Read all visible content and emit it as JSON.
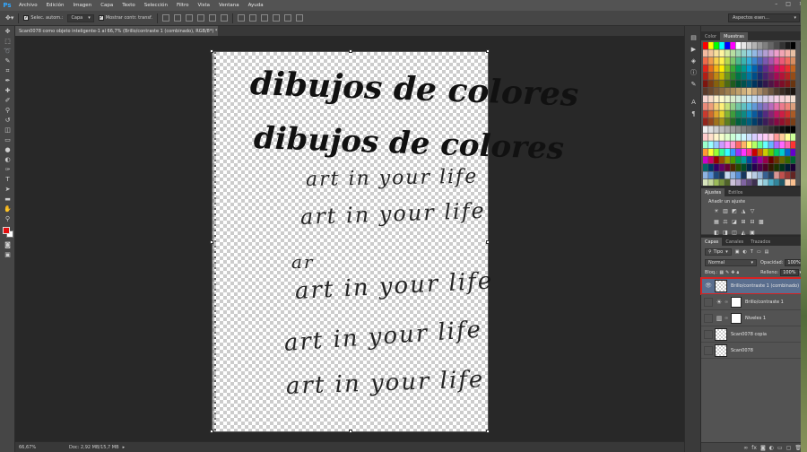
{
  "menubar": {
    "logo": "Ps",
    "items": [
      "Archivo",
      "Edición",
      "Imagen",
      "Capa",
      "Texto",
      "Selección",
      "Filtro",
      "Vista",
      "Ventana",
      "Ayuda"
    ],
    "minimize": "–",
    "maximize": "□",
    "close": "✕"
  },
  "options": {
    "auto_select_label": "Selec. autom.:",
    "auto_select_value": "Capa",
    "show_transform_label": "Mostrar contr. transf.",
    "workspace": "Aspectos esen..."
  },
  "document": {
    "tab_title": "Scan0078 como objeto inteligente-1 al 66,7% (Brillo/contraste 1 (combinado), RGB/8*) *",
    "tab_close": "×",
    "lines": [
      {
        "text": "dibujos de colores",
        "style": "bold"
      },
      {
        "text": "dibujos de colores",
        "style": "bold"
      },
      {
        "text": "art in your life",
        "style": "thin"
      },
      {
        "text": "art in your life",
        "style": "thin"
      },
      {
        "text": "ar",
        "style": "thin"
      },
      {
        "text": "art in your life",
        "style": "thin"
      },
      {
        "text": "art in your life",
        "style": "thin"
      },
      {
        "text": "art in your life",
        "style": "thin"
      }
    ]
  },
  "status": {
    "zoom": "66,67%",
    "doc": "Doc: 2,92 MB/15,7 MB"
  },
  "swatches": {
    "tabs": [
      "Color",
      "Muestras"
    ],
    "active": "Muestras",
    "top_row": [
      "#ff0000",
      "#ffff00",
      "#00ff00",
      "#00ffff",
      "#0000ff",
      "#ff00ff",
      "#ffffff",
      "#e6e6e6",
      "#cccccc",
      "#b3b3b3",
      "#999999",
      "#808080",
      "#666666",
      "#4d4d4d",
      "#333333",
      "#1a1a1a",
      "#000000"
    ],
    "rows": [
      [
        "#f2b9a0",
        "#f4c59a",
        "#f8e09b",
        "#fff5a0",
        "#d8eba0",
        "#b7dea0",
        "#9ed5b4",
        "#93d2cd",
        "#8fcfe7",
        "#93b9e3",
        "#9aa0d6",
        "#b39ed2",
        "#cf9ed3",
        "#ee9fcb",
        "#f2a5b4",
        "#f5b0a8",
        "#e8c0a4"
      ],
      [
        "#ed6a4a",
        "#f09a48",
        "#f7cf4a",
        "#fff14d",
        "#b5d84e",
        "#7bc46a",
        "#4cb88c",
        "#3bb4b0",
        "#36acd8",
        "#3c86cf",
        "#4f63b8",
        "#7d58b0",
        "#a852ae",
        "#e14e9a",
        "#ec5a78",
        "#f06a5e",
        "#d88e62"
      ],
      [
        "#e2231a",
        "#e8701a",
        "#f5b416",
        "#ffec00",
        "#8fc41f",
        "#3aa935",
        "#009a5b",
        "#009b8f",
        "#0099d3",
        "#0064b0",
        "#23388e",
        "#5e2b8f",
        "#942682",
        "#d50f6d",
        "#e6174a",
        "#ea2e2e",
        "#c2631e"
      ],
      [
        "#b21e15",
        "#b55718",
        "#c18a12",
        "#c8b800",
        "#6f981a",
        "#2c8329",
        "#007548",
        "#00766e",
        "#0077a3",
        "#004d88",
        "#1b2b6e",
        "#48216e",
        "#721d64",
        "#a50b54",
        "#b41239",
        "#b62323",
        "#954c17"
      ],
      [
        "#7d150f",
        "#7f3d11",
        "#87610c",
        "#8c8100",
        "#4e6b12",
        "#1f5c1d",
        "#005232",
        "#00524d",
        "#005372",
        "#00355f",
        "#131e4d",
        "#32174d",
        "#501446",
        "#73083b",
        "#7e0d28",
        "#801818",
        "#693510"
      ],
      [
        "#5a3a2a",
        "#6b4a30",
        "#7c5b38",
        "#8d6c42",
        "#9c7d4e",
        "#ad8e5c",
        "#bf9f6b",
        "#d0b07b",
        "#e1c18b",
        "#c7a57a",
        "#a88a66",
        "#8a6f52",
        "#6b5540",
        "#4d3b2e",
        "#3a2c22",
        "#2a1f18",
        "#1b140f"
      ],
      [
        "#f7d5d0",
        "#f9ddc8",
        "#fcefc8",
        "#fffbcc",
        "#ecf4cc",
        "#dbedcd",
        "#cfe9da",
        "#c9e8e5",
        "#c7e6f2",
        "#c9dcf1",
        "#ccd0ea",
        "#d8cfe8",
        "#e6cfe8",
        "#f6d0e5",
        "#f8d3da",
        "#fad7d3",
        "#f3dfd1"
      ],
      [
        "#e98a7a",
        "#ee9f7a",
        "#f6cf78",
        "#fff07a",
        "#c7e27a",
        "#94cf8a",
        "#6fc4a4",
        "#61c1c0",
        "#5cbbe2",
        "#6199d7",
        "#7077c4",
        "#9270bd",
        "#b86bbc",
        "#e670ab",
        "#ec7a8d",
        "#ef857b",
        "#dca07e"
      ],
      [
        "#c93a2e",
        "#cf6a2e",
        "#dea32c",
        "#e6d32c",
        "#86b432",
        "#3e9c3c",
        "#128a5e",
        "#0e8a82",
        "#0a88be",
        "#0a5b9e",
        "#1e347f",
        "#542a80",
        "#862576",
        "#c01664",
        "#ce1e45",
        "#d0302e",
        "#aa5b26"
      ],
      [
        "#92261d",
        "#95471e",
        "#a0721b",
        "#a6951a",
        "#5e7f1f",
        "#276b24",
        "#006040",
        "#00605b",
        "#00607f",
        "#003f6b",
        "#172659",
        "#3b1c59",
        "#5e1850",
        "#870943",
        "#930f2e",
        "#94201e",
        "#7a3f17"
      ],
      [
        "#f0f0f0",
        "#e0e0e0",
        "#d0d0d0",
        "#c0c0c0",
        "#b0b0b0",
        "#a0a0a0",
        "#909090",
        "#808080",
        "#707070",
        "#606060",
        "#505050",
        "#404040",
        "#303030",
        "#202020",
        "#101010",
        "#080808",
        "#000000"
      ],
      [
        "#ffcccc",
        "#ffe0cc",
        "#fff5cc",
        "#f5ffcc",
        "#e0ffcc",
        "#ccffd6",
        "#ccfff0",
        "#ccf5ff",
        "#cce0ff",
        "#d6ccff",
        "#f0ccff",
        "#ffccf5",
        "#ffcce0",
        "#ff9999",
        "#ffcc99",
        "#ffff99",
        "#ccff99"
      ],
      [
        "#99ffcc",
        "#99ffff",
        "#99ccff",
        "#cc99ff",
        "#ff99ff",
        "#ff99cc",
        "#ff6666",
        "#ffb366",
        "#ffff66",
        "#b3ff66",
        "#66ff99",
        "#66ffff",
        "#66b3ff",
        "#b366ff",
        "#ff66ff",
        "#ff66b3",
        "#ff3333"
      ],
      [
        "#ff9933",
        "#ffff33",
        "#99ff33",
        "#33ff99",
        "#33ffff",
        "#3399ff",
        "#9933ff",
        "#ff33ff",
        "#ff3399",
        "#cc0000",
        "#cc6600",
        "#cccc00",
        "#66cc00",
        "#00cc66",
        "#00cccc",
        "#0066cc",
        "#6600cc"
      ],
      [
        "#cc00cc",
        "#cc0066",
        "#990000",
        "#994c00",
        "#999900",
        "#4c9900",
        "#00994c",
        "#009999",
        "#004c99",
        "#4c0099",
        "#990099",
        "#99004c",
        "#660000",
        "#663300",
        "#666600",
        "#336600",
        "#006633"
      ],
      [
        "#006666",
        "#003366",
        "#330066",
        "#660066",
        "#660033",
        "#4d2600",
        "#264d00",
        "#004d26",
        "#00264d",
        "#26004d",
        "#4d004d",
        "#4d0026",
        "#331a00",
        "#1a3300",
        "#00331a",
        "#001a33",
        "#1a0033"
      ],
      [
        "#8db3e2",
        "#548dd4",
        "#1f497d",
        "#17365d",
        "#c6d9f0",
        "#8eb4e3",
        "#558ed5",
        "#17375e",
        "#dbe5f1",
        "#b8cce4",
        "#95b3d7",
        "#366092",
        "#244062",
        "#d99694",
        "#c0504d",
        "#953734",
        "#632523"
      ],
      [
        "#d7e4bd",
        "#c3d69b",
        "#9bbb59",
        "#76923c",
        "#4f6228",
        "#ccc1d9",
        "#b2a2c7",
        "#8064a2",
        "#5f497a",
        "#3f3151",
        "#b7dde8",
        "#92cddc",
        "#4bacc6",
        "#31859b",
        "#205867",
        "#fbd5b5",
        "#fac08f"
      ],
      [
        "#f79646",
        "#e36c09",
        "#974806",
        "#eeece1",
        "#ddd9c3",
        "#c4bd97",
        "#938953",
        "#494429",
        "#fde9d9",
        "#fbd4b4",
        "#fabf8f",
        "#e46c0a",
        "#984806",
        "#dbeef3",
        "#b6dde8",
        "#92cddc",
        "#31849b"
      ],
      [
        "#dde3f0",
        "#bcc7e2",
        "#9aabd3",
        "#7990c4",
        "#5874b5",
        "#3f5ba0",
        "#304680",
        "#223260",
        "#162040",
        "#e4dff0",
        "#c9bfe2",
        "#ae9fd3",
        "#937fc4",
        "#785fb5",
        "#5e479a",
        "#46357a",
        "#30245a"
      ]
    ]
  },
  "adjustments": {
    "tabs": [
      "Ajustes",
      "Estilos"
    ],
    "active": "Ajustes",
    "title": "Añadir un ajuste",
    "icons_row1": [
      "☀",
      "▥",
      "◩",
      "◮",
      "▽"
    ],
    "icons_row2": [
      "▦",
      "⚖",
      "◪",
      "⊞",
      "⊟",
      "▩"
    ],
    "icons_row3": [
      "◧",
      "◨",
      "◫",
      "◭",
      "▣"
    ]
  },
  "layers": {
    "tabs": [
      "Capas",
      "Canales",
      "Trazados"
    ],
    "active": "Capas",
    "filter_label": "Tipo",
    "blend_mode": "Normal",
    "opacity_label": "Opacidad:",
    "opacity_value": "100%",
    "lock_label": "Bloq.:",
    "fill_label": "Relleno:",
    "fill_value": "100%",
    "items": [
      {
        "name": "Brillo/contraste 1 (combinado)",
        "selected": true,
        "visible": true,
        "kind": "pixel"
      },
      {
        "name": "Brillo/contraste 1",
        "selected": false,
        "visible": false,
        "kind": "brightness"
      },
      {
        "name": "Niveles 1",
        "selected": false,
        "visible": false,
        "kind": "levels"
      },
      {
        "name": "Scan0078 copia",
        "selected": false,
        "visible": false,
        "kind": "pixel"
      },
      {
        "name": "Scan0078",
        "selected": false,
        "visible": false,
        "kind": "pixel"
      }
    ]
  },
  "colors": {
    "foreground": "#e10f0f",
    "background": "#ffffff",
    "highlight": "#d82222"
  }
}
